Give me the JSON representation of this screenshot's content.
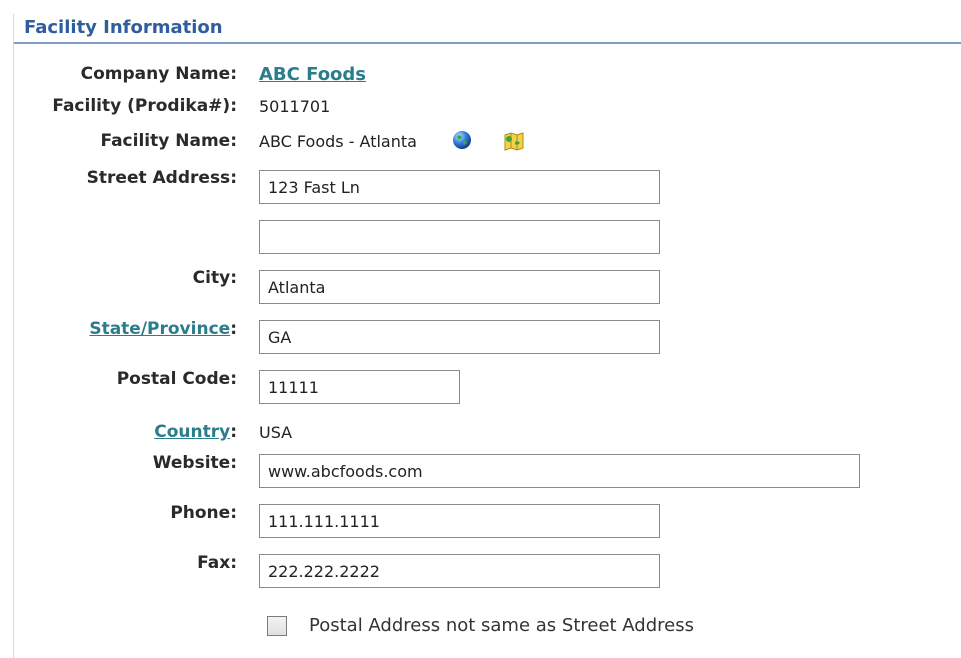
{
  "section": {
    "title": "Facility Information"
  },
  "fields": {
    "company_name": {
      "label": "Company Name",
      "value": "ABC Foods"
    },
    "facility_id": {
      "label": "Facility (Prodika#)",
      "value": "5011701"
    },
    "facility_name": {
      "label": "Facility Name",
      "value": "ABC Foods - Atlanta",
      "icons": [
        "globe-icon",
        "map-folder-icon"
      ]
    },
    "street_address": {
      "label": "Street Address",
      "line1": "123 Fast Ln",
      "line2": ""
    },
    "city": {
      "label": "City",
      "value": "Atlanta"
    },
    "state": {
      "label": "State/Province",
      "value": "GA"
    },
    "postal_code": {
      "label": "Postal Code",
      "value": "11111"
    },
    "country": {
      "label": "Country",
      "value": "USA"
    },
    "website": {
      "label": "Website",
      "value": "www.abcfoods.com"
    },
    "phone": {
      "label": "Phone",
      "value": "111.111.1111"
    },
    "fax": {
      "label": "Fax",
      "value": "222.222.2222"
    }
  },
  "postal_checkbox": {
    "label": "Postal Address not same as Street Address",
    "checked": false
  },
  "colors": {
    "title": "#2f5e9e",
    "link": "#2b7d8c",
    "header_rule": "#7f9dc4"
  }
}
